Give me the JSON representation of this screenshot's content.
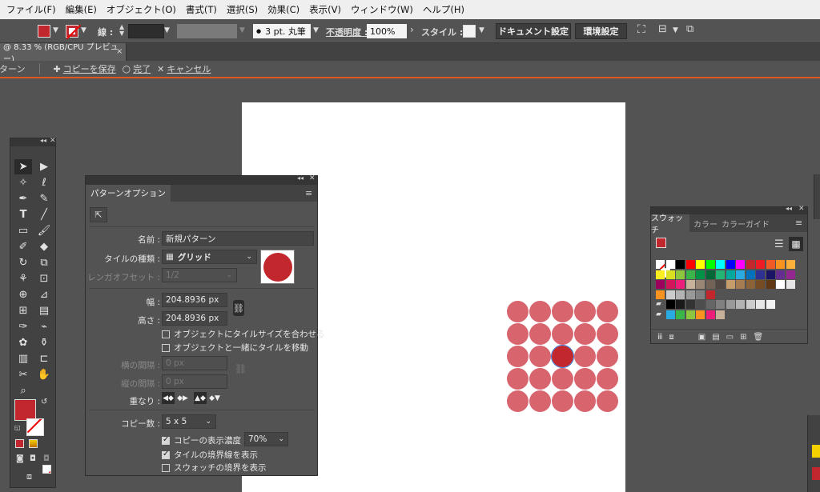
{
  "menu": [
    "ファイル(F)",
    "編集(E)",
    "オブジェクト(O)",
    "書式(T)",
    "選択(S)",
    "効果(C)",
    "表示(V)",
    "ウィンドウ(W)",
    "ヘルプ(H)"
  ],
  "control": {
    "stroke_label": "線 :",
    "brush_value": "3 pt. 丸筆",
    "opacity_label": "不透明度 :",
    "opacity_value": "100%",
    "style_label": "スタイル :",
    "doc_settings": "ドキュメント設定",
    "env_settings": "環境設定"
  },
  "tab": {
    "title": "@ 8.33 % (RGB/CPU プレビュー)",
    "close": "×"
  },
  "isolation": {
    "mode": "ターン",
    "save_copy": "コピーを保存",
    "done": "完了",
    "cancel": "キャンセル"
  },
  "pattern_options": {
    "tab": "パターンオプション",
    "name_label": "名前 :",
    "name_value": "新規パターン",
    "tile_type_label": "タイルの種類 :",
    "tile_type_value": "グリッド",
    "brick_offset_label": "レンガオフセット :",
    "brick_offset_value": "1/2",
    "width_label": "幅 :",
    "width_value": "204.8936 px",
    "height_label": "高さ :",
    "height_value": "204.8936 px",
    "fit_tile": "オブジェクトにタイルサイズを合わせる",
    "move_tile": "オブジェクトと一緒にタイルを移動",
    "h_spacing_label": "横の間隔 :",
    "h_spacing_value": "0 px",
    "v_spacing_label": "縦の間隔 :",
    "v_spacing_value": "0 px",
    "overlap_label": "重なり :",
    "copies_label": "コピー数 :",
    "copies_value": "5 x 5",
    "dim_copies": "コピーの表示濃度 :",
    "dim_value": "70%",
    "show_tile_edge": "タイルの境界線を表示",
    "show_swatch_bounds": "スウォッチの境界を表示",
    "fit_tile_checked": false,
    "move_tile_checked": false,
    "dim_copies_checked": true,
    "show_tile_edge_checked": true,
    "show_swatch_bounds_checked": false
  },
  "swatches": {
    "tabs": [
      "スウォッチ",
      "カラー",
      "カラーガイド"
    ]
  },
  "colors": {
    "fill": "#c1272d",
    "accent": "#e0571f",
    "pattern_dim": "#d8646e"
  }
}
